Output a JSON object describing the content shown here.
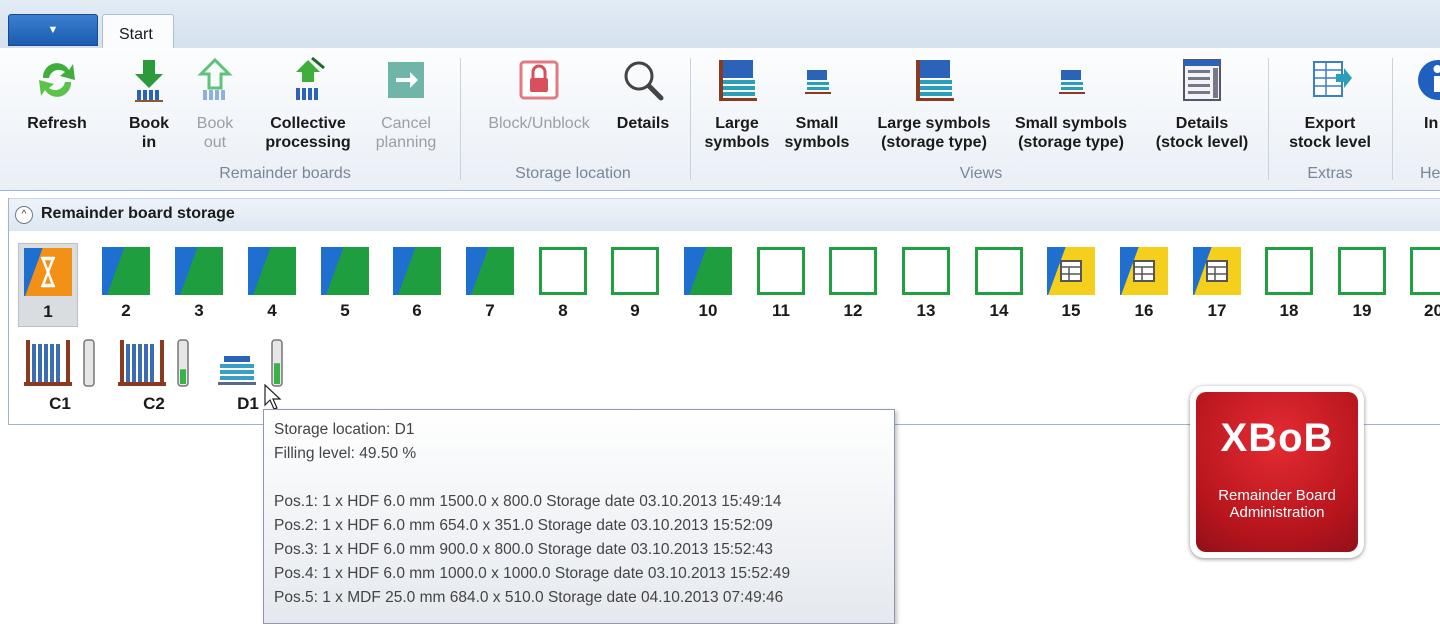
{
  "tabs": {
    "app_menu": "▼",
    "start": "Start"
  },
  "ribbon": {
    "buttons": {
      "refresh": "Refresh",
      "book_in": "Book\nin",
      "book_out": "Book\nout",
      "collective": "Collective\nprocessing",
      "cancel": "Cancel\nplanning",
      "block": "Block/Unblock",
      "details": "Details",
      "large": "Large\nsymbols",
      "small": "Small\nsymbols",
      "large_st": "Large symbols\n(storage type)",
      "small_st": "Small symbols\n(storage type)",
      "details_stock": "Details\n(stock level)",
      "export": "Export\nstock level",
      "info": "In"
    },
    "groups": {
      "remainder": "Remainder boards",
      "storage": "Storage location",
      "views": "Views",
      "extras": "Extras",
      "help": "He"
    }
  },
  "section": {
    "title": "Remainder board storage",
    "collapse_icon": "^"
  },
  "slots": [
    {
      "num": "1",
      "state": "busy"
    },
    {
      "num": "2",
      "state": "full"
    },
    {
      "num": "3",
      "state": "full"
    },
    {
      "num": "4",
      "state": "full"
    },
    {
      "num": "5",
      "state": "full"
    },
    {
      "num": "6",
      "state": "full"
    },
    {
      "num": "7",
      "state": "full"
    },
    {
      "num": "8",
      "state": "empty"
    },
    {
      "num": "9",
      "state": "empty"
    },
    {
      "num": "10",
      "state": "full"
    },
    {
      "num": "11",
      "state": "empty"
    },
    {
      "num": "12",
      "state": "empty"
    },
    {
      "num": "13",
      "state": "empty"
    },
    {
      "num": "14",
      "state": "empty"
    },
    {
      "num": "15",
      "state": "reserved"
    },
    {
      "num": "16",
      "state": "reserved"
    },
    {
      "num": "17",
      "state": "reserved"
    },
    {
      "num": "18",
      "state": "empty"
    },
    {
      "num": "19",
      "state": "empty"
    },
    {
      "num": "20",
      "state": "empty"
    }
  ],
  "racks": [
    {
      "num": "C1",
      "fill": 0.0
    },
    {
      "num": "C2",
      "fill": 0.35
    },
    {
      "num": "D1",
      "fill": 0.495
    }
  ],
  "tooltip": {
    "location": "Storage location: D1",
    "filling": "Filling level: 49.50 %",
    "pos1": "Pos.1: 1 x HDF 6.0 mm 1500.0 x 800.0  Storage date 03.10.2013 15:49:14",
    "pos2": "Pos.2: 1 x HDF 6.0 mm 654.0 x 351.0  Storage date 03.10.2013 15:52:09",
    "pos3": "Pos.3: 1 x HDF 6.0 mm 900.0 x 800.0  Storage date 03.10.2013 15:52:43",
    "pos4": "Pos.4: 1 x HDF 6.0 mm 1000.0 x 1000.0  Storage date 03.10.2013 15:52:49",
    "pos5": "Pos.5: 1 x MDF 25.0 mm 684.0 x 510.0  Storage date 04.10.2013 07:49:46"
  },
  "logo": {
    "title": "XBoB",
    "subtitle1": "Remainder Board",
    "subtitle2": "Administration"
  },
  "colors": {
    "accent": "#1e6fd0",
    "green": "#1e9e3e",
    "yellow": "#f4cf1c",
    "orange": "#f39016",
    "logo_red": "#d1212a"
  }
}
